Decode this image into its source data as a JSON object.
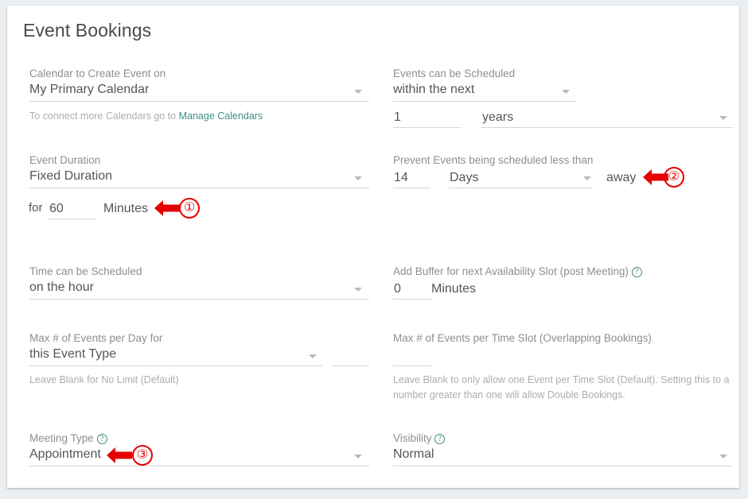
{
  "page": {
    "title": "Event Bookings"
  },
  "fields": {
    "calendar": {
      "label": "Calendar to Create Event on",
      "value": "My Primary Calendar",
      "hint_prefix": "To connect more Calendars go to ",
      "hint_link": "Manage Calendars"
    },
    "schedule_window": {
      "label": "Events can be Scheduled",
      "mode": "within the next",
      "amount": "1",
      "unit": "years"
    },
    "event_duration": {
      "label": "Event Duration",
      "value": "Fixed Duration",
      "for_prefix": "for",
      "minutes_value": "60",
      "minutes_unit": "Minutes"
    },
    "prevent_events": {
      "label": "Prevent Events being scheduled less than",
      "amount": "14",
      "unit": "Days",
      "suffix": "away"
    },
    "time_scheduled": {
      "label": "Time can be Scheduled",
      "value": "on the hour"
    },
    "buffer": {
      "label": "Add Buffer for next Availability Slot (post Meeting)",
      "help_icon": "help-circle-icon",
      "value": "0",
      "unit": "Minutes"
    },
    "max_per_day": {
      "label": "Max # of Events per Day for",
      "value": "this Event Type",
      "count_value": "",
      "hint": "Leave Blank for No Limit (Default)"
    },
    "max_per_slot": {
      "label": "Max # of Events per Time Slot (Overlapping Bookings)",
      "value": "",
      "hint": "Leave Blank to only allow one Event per Time Slot (Default). Setting this to a number greater than one will allow Double Bookings."
    },
    "meeting_type": {
      "label": "Meeting Type",
      "help_icon": "help-circle-icon",
      "value": "Appointment"
    },
    "visibility": {
      "label": "Visibility",
      "help_icon": "help-circle-icon",
      "value": "Normal"
    }
  },
  "annotations": [
    {
      "number": "①",
      "points_to": "Minutes"
    },
    {
      "number": "②",
      "points_to": "away"
    },
    {
      "number": "③",
      "points_to": "Appointment"
    }
  ],
  "colors": {
    "accent_link": "#3f8f83",
    "annotation": "#e60000",
    "card_background": "#ffffff",
    "page_background": "#eceff1"
  }
}
